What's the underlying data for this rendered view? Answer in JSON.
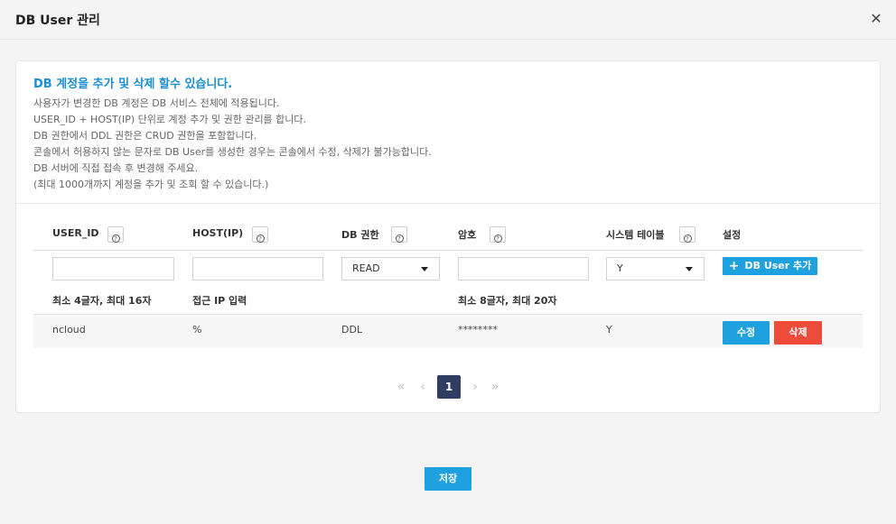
{
  "dialog": {
    "title": "DB User 관리",
    "close_glyph": "✕"
  },
  "notice": {
    "heading": "DB 계정을 추가 및 삭제 할수 있습니다.",
    "lines": [
      "사용자가 변경한 DB 계정은 DB 서비스 전체에 적용됩니다.",
      "USER_ID + HOST(IP) 단위로 계정 추가 및 권한 관리를 합니다.",
      "DB 권한에서 DDL 권한은 CRUD 권한을 포함합니다.",
      "콘솔에서 허용하지 않는 문자로 DB User를 생성한 경우는 콘솔에서 수정, 삭제가 불가능합니다.",
      "DB 서버에 직접 접속 후 변경해 주세요.",
      "(최대 1000개까지 계정을 추가 및 조회 할 수 있습니다.)"
    ]
  },
  "table": {
    "headers": {
      "user_id": "USER_ID",
      "host": "HOST(IP)",
      "privilege": "DB 권한",
      "password": "암호",
      "system_table": "시스템 테이블",
      "settings": "설정"
    },
    "help_glyph": "?",
    "new_row": {
      "user_id_value": "",
      "host_value": "",
      "privilege_selected": "READ",
      "password_value": "",
      "system_table_selected": "Y",
      "add_button_label": "DB User 추가",
      "add_button_icon": "+"
    },
    "hints": {
      "user_id": "최소 4글자, 최대 16자",
      "host": "접근 IP 입력",
      "password": "최소 8글자, 최대 20자"
    },
    "rows": [
      {
        "user_id": "ncloud",
        "host": "%",
        "privilege": "DDL",
        "password": "********",
        "system_table": "Y",
        "edit_label": "수정",
        "delete_label": "삭제"
      }
    ]
  },
  "pagination": {
    "first": "«",
    "prev": "‹",
    "current": "1",
    "next": "›",
    "last": "»"
  },
  "footer": {
    "save_label": "저장"
  },
  "colors": {
    "accent": "#1fa1e0",
    "danger": "#ee4c3a",
    "heading": "#1a8fd6",
    "pager_active": "#2f3e60"
  }
}
